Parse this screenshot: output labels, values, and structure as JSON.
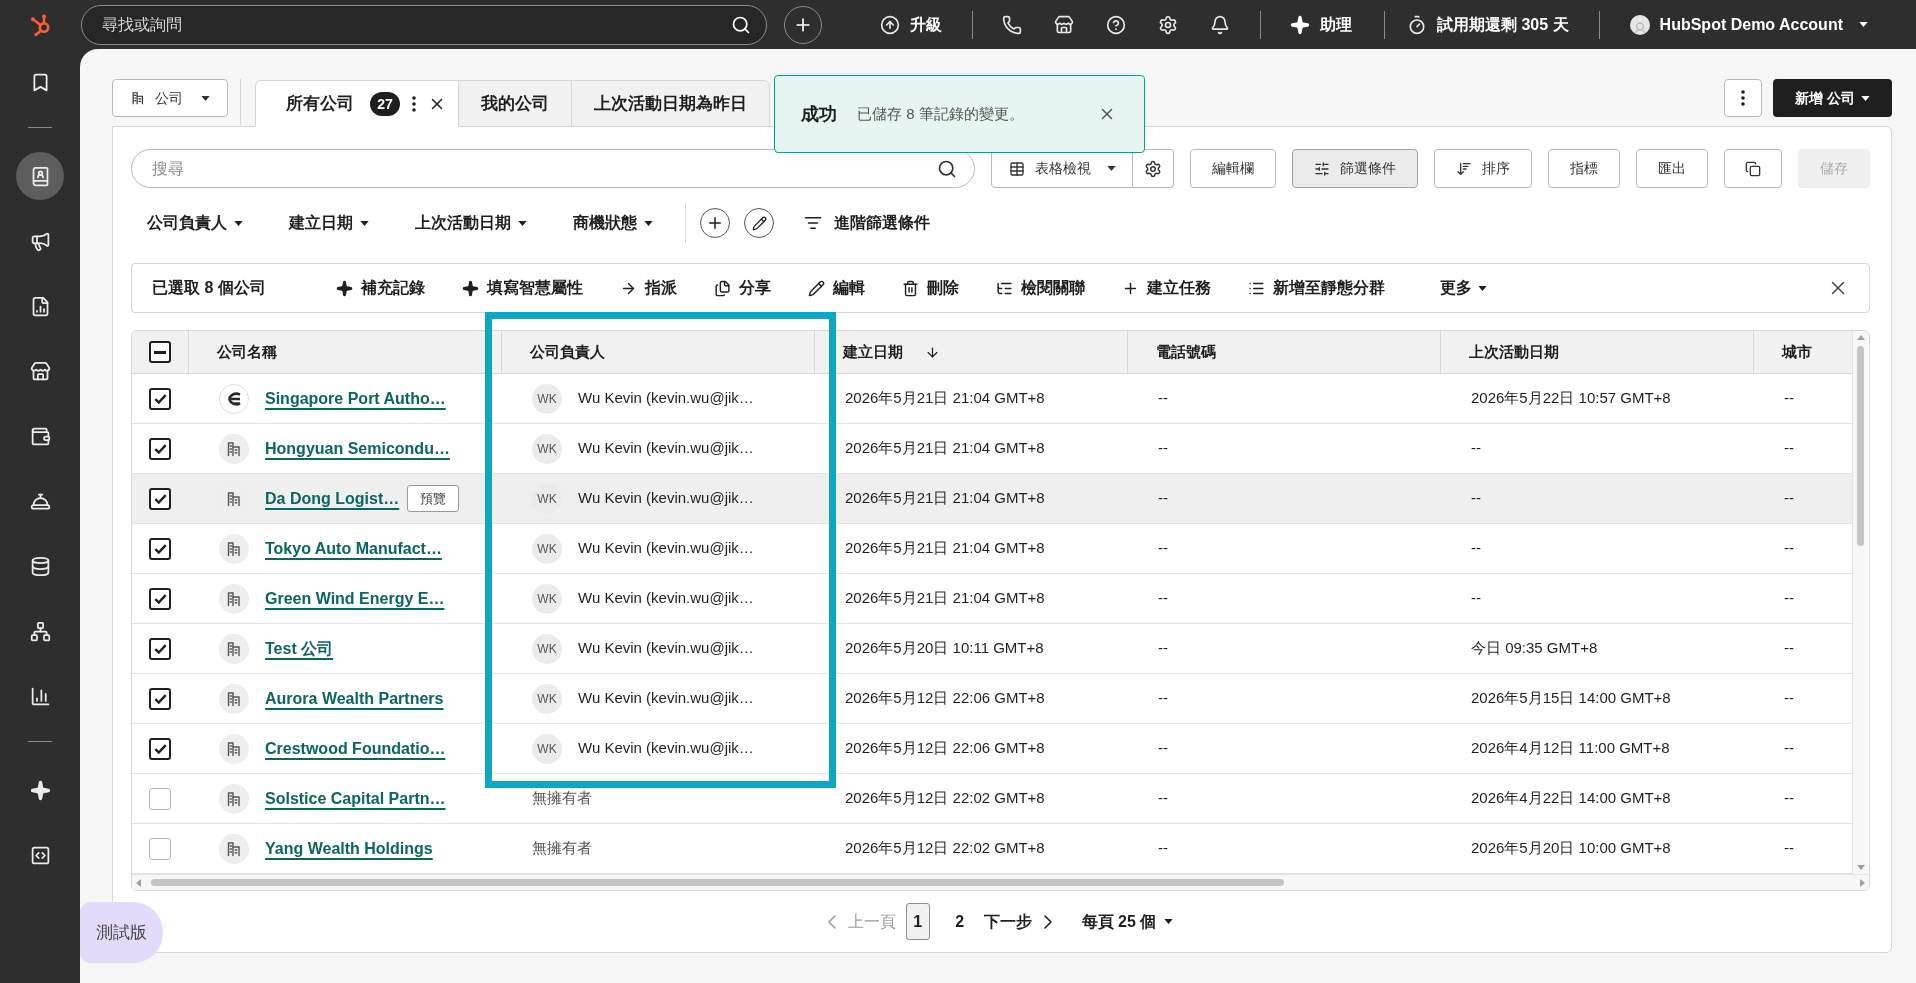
{
  "top_bar": {
    "search": {
      "placeholder": "尋找或詢問"
    },
    "upgrade": "升級",
    "assistant": "助理",
    "trial": "試用期還剩 305 天",
    "account": "HubSpot Demo Account"
  },
  "sidebar": {
    "groups": [
      {
        "items": [
          {
            "selected": false
          }
        ]
      },
      {
        "items": [
          {
            "selected": true
          },
          {
            "selected": false
          },
          {
            "selected": false
          },
          {
            "selected": false
          },
          {
            "selected": false
          },
          {
            "selected": false
          },
          {
            "selected": false
          },
          {
            "selected": false
          },
          {
            "selected": false
          }
        ]
      },
      {
        "items": [
          {
            "selected": false
          },
          {
            "selected": false
          }
        ]
      }
    ]
  },
  "object_switcher": "公司",
  "tabs": [
    {
      "label": "所有公司",
      "count": "27",
      "selected": true
    },
    {
      "label": "我的公司",
      "selected": false
    },
    {
      "label": "上次活動日期為昨日",
      "selected": false
    }
  ],
  "toast": {
    "title": "成功",
    "message": "已儲存 8 筆記錄的變更。"
  },
  "create_button": "新增 公司",
  "search": {
    "placeholder": "搜尋"
  },
  "view_select": "表格檢視",
  "toolbar_buttons": [
    {
      "label": "編輯欄",
      "active": false,
      "disabled": false
    },
    {
      "label": "篩選條件",
      "active": true,
      "disabled": false
    },
    {
      "label": "排序",
      "active": false,
      "disabled": false
    },
    {
      "label": "指標",
      "active": false,
      "disabled": false
    },
    {
      "label": "匯出",
      "active": false,
      "disabled": false
    },
    {
      "active": false,
      "disabled": false
    },
    {
      "label": "儲存",
      "active": false,
      "disabled": true
    }
  ],
  "filters": [
    {
      "label": "公司負責人"
    },
    {
      "label": "建立日期"
    },
    {
      "label": "上次活動日期"
    },
    {
      "label": "商機狀態"
    }
  ],
  "advanced_filters": "進階篩選條件",
  "bulk_bar": {
    "selection": "已選取 8 個公司",
    "actions": [
      {
        "label": "補充記錄",
        "kind": "action"
      },
      {
        "label": "填寫智慧屬性",
        "kind": "action"
      },
      {
        "label": "指派",
        "kind": "action"
      },
      {
        "label": "分享",
        "kind": "action"
      },
      {
        "label": "編輯",
        "kind": "action"
      },
      {
        "label": "刪除",
        "kind": "action"
      },
      {
        "label": "檢閱關聯",
        "kind": "action"
      },
      {
        "label": "建立任務",
        "kind": "action"
      },
      {
        "label": "新增至靜態分群",
        "kind": "action"
      },
      {
        "label": "更多",
        "kind": "menu"
      }
    ]
  },
  "table": {
    "select_all": {
      "indeterminate": true
    },
    "columns": [
      {
        "label": "公司名稱",
        "sorted": false,
        "highlighted": false
      },
      {
        "label": "公司負責人",
        "sorted": false,
        "highlighted": true
      },
      {
        "label": "建立日期",
        "sorted": true,
        "highlighted": false
      },
      {
        "label": "電話號碼",
        "sorted": false,
        "highlighted": false
      },
      {
        "label": "上次活動日期",
        "sorted": false,
        "highlighted": false
      },
      {
        "label": "城市",
        "sorted": false,
        "highlighted": false
      }
    ],
    "rows": [
      {
        "checked": true,
        "hovered": false,
        "cells": [
          {
            "kind": "company_logo",
            "text": "Singapore Port Autho…"
          },
          {
            "kind": "owner",
            "initials": "WK",
            "text": "Wu Kevin (kevin.wu@jik…"
          },
          {
            "kind": "text",
            "text": "2026年5月21日 21:04 GMT+8"
          },
          {
            "kind": "text",
            "text": "--"
          },
          {
            "kind": "text",
            "text": "2026年5月22日 10:57 GMT+8"
          },
          {
            "kind": "text",
            "text": "--"
          }
        ]
      },
      {
        "checked": true,
        "hovered": false,
        "cells": [
          {
            "kind": "company",
            "text": "Hongyuan Semicondu…"
          },
          {
            "kind": "owner",
            "initials": "WK",
            "text": "Wu Kevin (kevin.wu@jik…"
          },
          {
            "kind": "text",
            "text": "2026年5月21日 21:04 GMT+8"
          },
          {
            "kind": "text",
            "text": "--"
          },
          {
            "kind": "text",
            "text": "--"
          },
          {
            "kind": "text",
            "text": "--"
          }
        ]
      },
      {
        "checked": true,
        "hovered": true,
        "cells": [
          {
            "kind": "company",
            "text": "Da Dong Logist…",
            "preview": "預覽"
          },
          {
            "kind": "owner",
            "initials": "WK",
            "text": "Wu Kevin (kevin.wu@jik…"
          },
          {
            "kind": "text",
            "text": "2026年5月21日 21:04 GMT+8"
          },
          {
            "kind": "text",
            "text": "--"
          },
          {
            "kind": "text",
            "text": "--"
          },
          {
            "kind": "text",
            "text": "--"
          }
        ]
      },
      {
        "checked": true,
        "hovered": false,
        "cells": [
          {
            "kind": "company",
            "text": "Tokyo Auto Manufact…"
          },
          {
            "kind": "owner",
            "initials": "WK",
            "text": "Wu Kevin (kevin.wu@jik…"
          },
          {
            "kind": "text",
            "text": "2026年5月21日 21:04 GMT+8"
          },
          {
            "kind": "text",
            "text": "--"
          },
          {
            "kind": "text",
            "text": "--"
          },
          {
            "kind": "text",
            "text": "--"
          }
        ]
      },
      {
        "checked": true,
        "hovered": false,
        "cells": [
          {
            "kind": "company",
            "text": "Green Wind Energy E…"
          },
          {
            "kind": "owner",
            "initials": "WK",
            "text": "Wu Kevin (kevin.wu@jik…"
          },
          {
            "kind": "text",
            "text": "2026年5月21日 21:04 GMT+8"
          },
          {
            "kind": "text",
            "text": "--"
          },
          {
            "kind": "text",
            "text": "--"
          },
          {
            "kind": "text",
            "text": "--"
          }
        ]
      },
      {
        "checked": true,
        "hovered": false,
        "cells": [
          {
            "kind": "company",
            "text": "Test 公司"
          },
          {
            "kind": "owner",
            "initials": "WK",
            "text": "Wu Kevin (kevin.wu@jik…"
          },
          {
            "kind": "text",
            "text": "2026年5月20日 10:11 GMT+8"
          },
          {
            "kind": "text",
            "text": "--"
          },
          {
            "kind": "text",
            "text": "今日 09:35 GMT+8"
          },
          {
            "kind": "text",
            "text": "--"
          }
        ]
      },
      {
        "checked": true,
        "hovered": false,
        "cells": [
          {
            "kind": "company",
            "text": "Aurora Wealth Partners"
          },
          {
            "kind": "owner",
            "initials": "WK",
            "text": "Wu Kevin (kevin.wu@jik…"
          },
          {
            "kind": "text",
            "text": "2026年5月12日 22:06 GMT+8"
          },
          {
            "kind": "text",
            "text": "--"
          },
          {
            "kind": "text",
            "text": "2026年5月15日 14:00 GMT+8"
          },
          {
            "kind": "text",
            "text": "--"
          }
        ]
      },
      {
        "checked": true,
        "hovered": false,
        "cells": [
          {
            "kind": "company",
            "text": "Crestwood Foundatio…"
          },
          {
            "kind": "owner",
            "initials": "WK",
            "text": "Wu Kevin (kevin.wu@jik…"
          },
          {
            "kind": "text",
            "text": "2026年5月12日 22:06 GMT+8"
          },
          {
            "kind": "text",
            "text": "--"
          },
          {
            "kind": "text",
            "text": "2026年4月12日 11:00 GMT+8"
          },
          {
            "kind": "text",
            "text": "--"
          }
        ]
      },
      {
        "checked": false,
        "hovered": false,
        "cells": [
          {
            "kind": "company",
            "text": "Solstice Capital Partn…"
          },
          {
            "kind": "owner",
            "text": "無擁有者"
          },
          {
            "kind": "text",
            "text": "2026年5月12日 22:02 GMT+8"
          },
          {
            "kind": "text",
            "text": "--"
          },
          {
            "kind": "text",
            "text": "2026年4月22日 14:00 GMT+8"
          },
          {
            "kind": "text",
            "text": "--"
          }
        ]
      },
      {
        "checked": false,
        "hovered": false,
        "cells": [
          {
            "kind": "company",
            "text": "Yang Wealth Holdings"
          },
          {
            "kind": "owner",
            "text": "無擁有者"
          },
          {
            "kind": "text",
            "text": "2026年5月12日 22:02 GMT+8"
          },
          {
            "kind": "text",
            "text": "--"
          },
          {
            "kind": "text",
            "text": "2026年5月20日 10:00 GMT+8"
          },
          {
            "kind": "text",
            "text": "--"
          }
        ]
      }
    ]
  },
  "pagination": {
    "previous": {
      "label": "上一頁",
      "disabled": true
    },
    "pages": [
      {
        "label": "1",
        "selected": true
      },
      {
        "label": "2",
        "selected": false
      }
    ],
    "next": {
      "label": "下一步",
      "disabled": false
    },
    "page_size": "每頁 25 個"
  },
  "beta_badge": "測試版"
}
